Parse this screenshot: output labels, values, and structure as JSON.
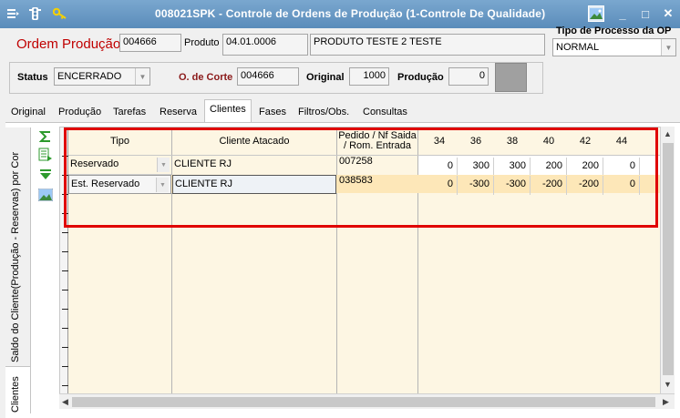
{
  "window": {
    "title": "008021SPK - Controle de Ordens de Produção (1-Controle De Qualidade)",
    "menu_icon": "menu-icon",
    "traffic_icon": "traffic-light-icon",
    "key_icon": "key-icon",
    "image_icon": "picture-icon",
    "minimize": "_",
    "maximize": "□",
    "close": "✕"
  },
  "header": {
    "ordem_label": "Ordem Produção",
    "ordem_value": "004666",
    "produto_label": "Produto",
    "produto_code": "04.01.0006",
    "produto_desc": "PRODUTO TESTE 2 TESTE",
    "tipo_processo_label": "Tipo de Processo da OP",
    "tipo_processo_value": "NORMAL",
    "status_label": "Status",
    "status_value": "ENCERRADO",
    "corte_label": "O. de Corte",
    "corte_value": "004666",
    "original_label": "Original",
    "original_value": "1000",
    "producao_label": "Produção",
    "producao_value": "0"
  },
  "tabs": [
    "Original",
    "Produção",
    "Tarefas",
    "Reserva",
    "Clientes",
    "Fases",
    "Filtros/Obs.",
    "Consultas"
  ],
  "active_tab": "Clientes",
  "vertical_tabs": {
    "top": "Saldo do Cliente(Produção - Reservas) por Cor",
    "bottom": "Clientes"
  },
  "grid": {
    "headers": {
      "tipo": "Tipo",
      "cliente": "Cliente Atacado",
      "pedido_line1": "Pedido /  Nf Saida",
      "pedido_line2": "/ Rom. Entrada",
      "sizes": [
        "34",
        "36",
        "38",
        "40",
        "42",
        "44"
      ]
    },
    "rows": [
      {
        "tipo": "Reservado",
        "cliente": "CLIENTE RJ",
        "pedido": "007258",
        "values": [
          "0",
          "300",
          "300",
          "200",
          "200",
          "0"
        ]
      },
      {
        "tipo": "Est. Reservado",
        "cliente": "CLIENTE RJ",
        "pedido": "038583",
        "values": [
          "0",
          "-300",
          "-300",
          "-200",
          "-200",
          "0"
        ]
      }
    ]
  },
  "colors": {
    "titlebar": "#6a9ac5",
    "highlight_box": "#e00000",
    "grid_bg": "#fdf6e3",
    "row_highlight": "#fde7b8"
  }
}
